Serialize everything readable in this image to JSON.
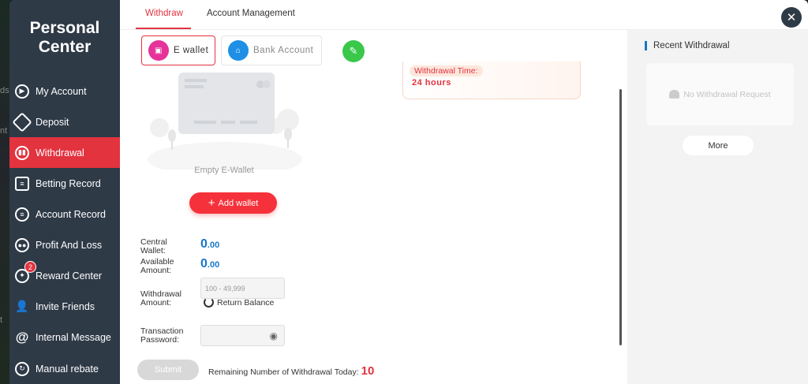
{
  "background": {
    "fragments": [
      "ds",
      "nt",
      "t"
    ]
  },
  "sidebar": {
    "title_line1": "Personal",
    "title_line2": "Center",
    "items": [
      {
        "label": "My Account",
        "icon": "account-icon"
      },
      {
        "label": "Deposit",
        "icon": "deposit-icon"
      },
      {
        "label": "Withdrawal",
        "icon": "withdrawal-icon"
      },
      {
        "label": "Betting Record",
        "icon": "betting-record-icon"
      },
      {
        "label": "Account Record",
        "icon": "account-record-icon"
      },
      {
        "label": "Profit And Loss",
        "icon": "profit-loss-icon"
      },
      {
        "label": "Reward Center",
        "icon": "reward-icon",
        "badge": "2"
      },
      {
        "label": "Invite Friends",
        "icon": "invite-icon"
      },
      {
        "label": "Internal Message",
        "icon": "message-icon"
      },
      {
        "label": "Manual rebate",
        "icon": "rebate-icon"
      }
    ],
    "active": "Withdrawal"
  },
  "tabs": [
    {
      "label": "Withdraw",
      "active": true
    },
    {
      "label": "Account Management",
      "active": false
    }
  ],
  "wallet_types": [
    {
      "label": "E wallet",
      "active": true,
      "color": "#e6339a"
    },
    {
      "label": "Bank Account",
      "active": false,
      "color": "#1f8fe6"
    }
  ],
  "withdrawal_time": {
    "label": "Withdrawal Time:",
    "value": "24 hours"
  },
  "empty_wallet": "Empty E-Wallet",
  "add_wallet": "Add wallet",
  "form": {
    "central_wallet_label_1": "Central",
    "central_wallet_label_2": "Wallet:",
    "central_wallet_int": "0",
    "central_wallet_dec": ".00",
    "available_label_1": "Available",
    "available_label_2": "Amount:",
    "available_int": "0",
    "available_dec": ".00",
    "withdrawal_label_1": "Withdrawal",
    "withdrawal_label_2": "Amount:",
    "withdrawal_placeholder": "100 - 49,999",
    "return_balance": "Return Balance",
    "password_label_1": "Transaction",
    "password_label_2": "Password:"
  },
  "submit": "Submit",
  "remaining_label": "Remaining Number of Withdrawal Today:",
  "remaining_count": "10",
  "recent": {
    "title": "Recent Withdrawal",
    "empty": "No Withdrawal Request",
    "more": "More"
  },
  "colors": {
    "accent": "#e2333f",
    "sidebar": "#2f3a47",
    "amount": "#1677c8",
    "edit": "#39c84a"
  }
}
